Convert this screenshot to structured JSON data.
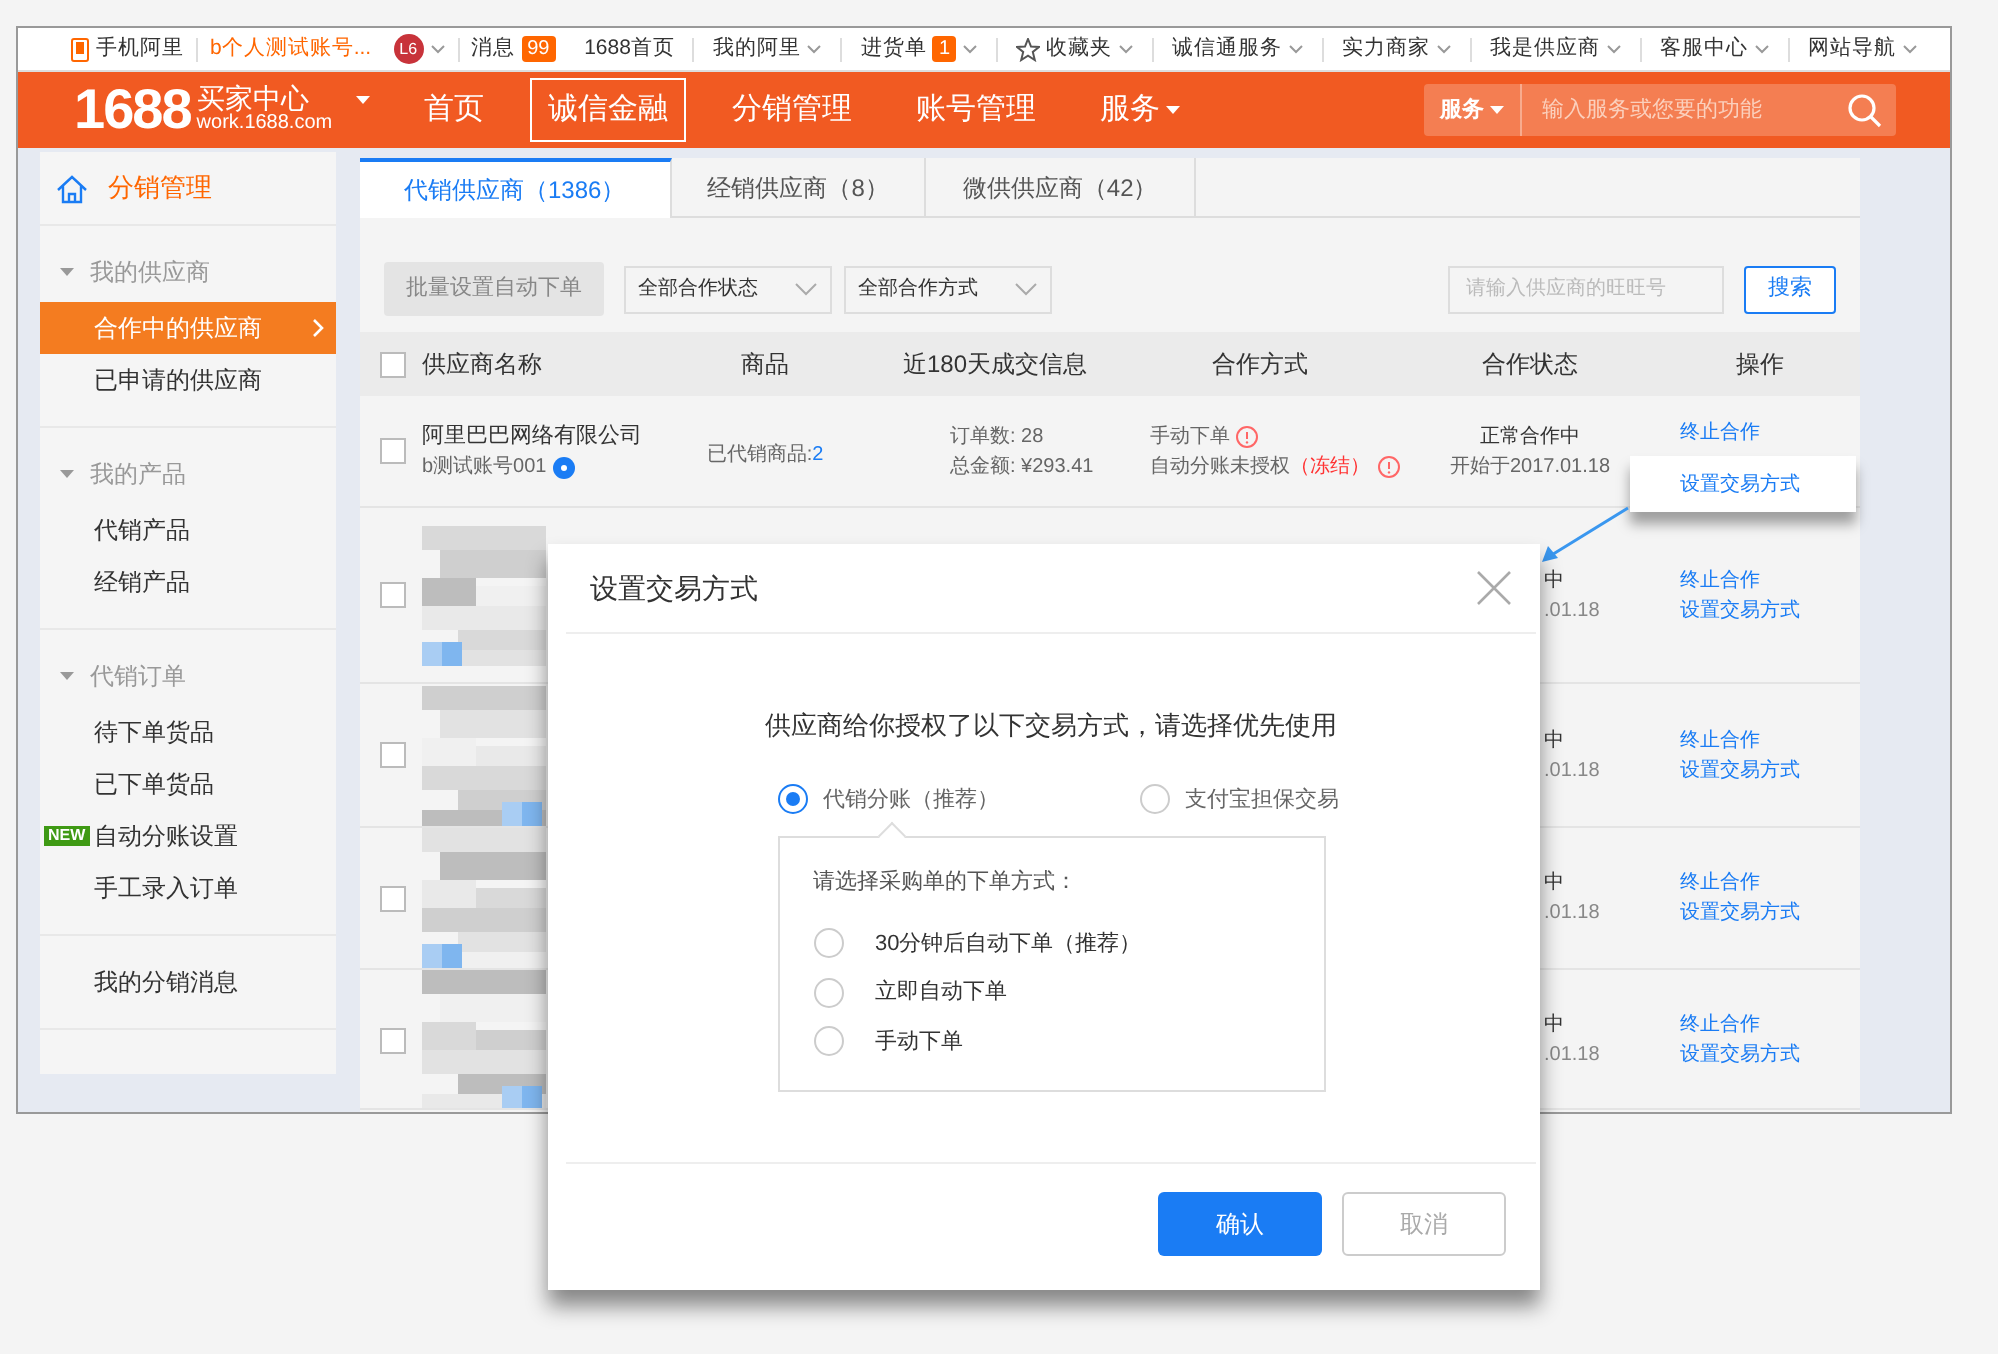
{
  "topbar": {
    "left": [
      {
        "kind": "phone",
        "label": "手机阿里"
      },
      {
        "kind": "account",
        "label": "b个人测试账号...",
        "badge": "L6"
      },
      {
        "kind": "message",
        "label": "消息",
        "count": "99"
      }
    ],
    "links": [
      {
        "label": "1688首页",
        "dropdown": false
      },
      {
        "label": "我的阿里",
        "dropdown": true
      },
      {
        "label": "进货单",
        "dropdown": true,
        "count": "1"
      },
      {
        "label": "收藏夹",
        "dropdown": true,
        "kind": "star"
      },
      {
        "label": "诚信通服务",
        "dropdown": true
      },
      {
        "label": "实力商家",
        "dropdown": true
      },
      {
        "label": "我是供应商",
        "dropdown": true
      },
      {
        "label": "客服中心",
        "dropdown": true
      },
      {
        "label": "网站导航",
        "dropdown": true
      }
    ]
  },
  "header": {
    "logo": "1688",
    "title": "买家中心",
    "subtitle": "work.1688.com",
    "nav": [
      {
        "label": "首页",
        "selected": false,
        "dropdown": false
      },
      {
        "label": "诚信金融",
        "selected": true,
        "dropdown": false
      },
      {
        "label": "分销管理",
        "selected": false,
        "dropdown": false
      },
      {
        "label": "账号管理",
        "selected": false,
        "dropdown": false
      },
      {
        "label": "服务",
        "selected": false,
        "dropdown": true
      }
    ],
    "search": {
      "scope": "服务",
      "placeholder": "输入服务或您要的功能"
    }
  },
  "sidebar": {
    "title": "分销管理",
    "groups": [
      {
        "title": "我的供应商",
        "expanded": true,
        "items": [
          {
            "label": "合作中的供应商",
            "selected": true
          },
          {
            "label": "已申请的供应商",
            "selected": false
          }
        ]
      },
      {
        "title": "我的产品",
        "expanded": true,
        "items": [
          {
            "label": "代销产品",
            "selected": false
          },
          {
            "label": "经销产品",
            "selected": false
          }
        ]
      },
      {
        "title": "代销订单",
        "expanded": true,
        "items": [
          {
            "label": "待下单货品",
            "selected": false
          },
          {
            "label": "已下单货品",
            "selected": false
          },
          {
            "label": "自动分账设置",
            "selected": false,
            "badge": "NEW"
          },
          {
            "label": "手工录入订单",
            "selected": false
          }
        ]
      },
      {
        "items": [
          {
            "label": "我的分销消息",
            "selected": false
          }
        ]
      }
    ]
  },
  "tabs": [
    {
      "label": "代销供应商（1386）",
      "selected": true
    },
    {
      "label": "经销供应商（8）",
      "selected": false
    },
    {
      "label": "微供供应商（42）",
      "selected": false
    }
  ],
  "toolbar": {
    "batch_button": {
      "label": "批量设置自动下单",
      "disabled": true
    },
    "filters": [
      "全部合作状态",
      "全部合作方式"
    ],
    "search_placeholder": "请输入供应商的旺旺号",
    "search_button": "搜索"
  },
  "table": {
    "all_checked": false,
    "columns": [
      "供应商名称",
      "商品",
      "近180天成交信息",
      "合作方式",
      "合作状态",
      "操作"
    ],
    "rows": [
      {
        "kind": "full",
        "checked": false,
        "name": "阿里巴巴网络有限公司",
        "account": "b测试账号001",
        "goods_label": "已代销商品:",
        "goods_count": "2",
        "orders": "订单数: 28",
        "amount": "总金额: ¥293.41",
        "mode": "手动下单",
        "auth": "自动分账未授权",
        "auth_state": "（冻结）",
        "status": "正常合作中",
        "since": "开始于2017.01.18",
        "actions": [
          {
            "label": "终止合作",
            "callout": false
          },
          {
            "label": "设置交易方式",
            "callout": true
          }
        ]
      },
      {
        "kind": "hidden",
        "checked": false,
        "status": "中",
        "since": ".01.18",
        "actions": [
          {
            "label": "终止合作",
            "callout": false
          },
          {
            "label": "设置交易方式",
            "callout": false
          }
        ]
      },
      {
        "kind": "hidden",
        "checked": false,
        "status": "中",
        "since": ".01.18",
        "actions": [
          {
            "label": "终止合作",
            "callout": false
          },
          {
            "label": "设置交易方式",
            "callout": false
          }
        ]
      },
      {
        "kind": "hidden",
        "checked": false,
        "status": "中",
        "since": ".01.18",
        "actions": [
          {
            "label": "终止合作",
            "callout": false
          },
          {
            "label": "设置交易方式",
            "callout": false
          }
        ]
      },
      {
        "kind": "hidden",
        "checked": false,
        "status": "中",
        "since": ".01.18",
        "actions": [
          {
            "label": "终止合作",
            "callout": false
          },
          {
            "label": "设置交易方式",
            "callout": false
          }
        ]
      }
    ]
  },
  "dialog": {
    "title": "设置交易方式",
    "prompt": "供应商给你授权了以下交易方式，请选择优先使用",
    "options": [
      {
        "label": "代销分账（推荐）",
        "selected": true
      },
      {
        "label": "支付宝担保交易",
        "selected": false
      }
    ],
    "sub_title": "请选择采购单的下单方式：",
    "sub_options": [
      {
        "label": "30分钟后自动下单（推荐）",
        "selected": false
      },
      {
        "label": "立即自动下单",
        "selected": false
      },
      {
        "label": "手动下单",
        "selected": false
      }
    ],
    "buttons": [
      {
        "label": "确认",
        "kind": "primary"
      },
      {
        "label": "取消",
        "kind": "secondary"
      }
    ]
  }
}
